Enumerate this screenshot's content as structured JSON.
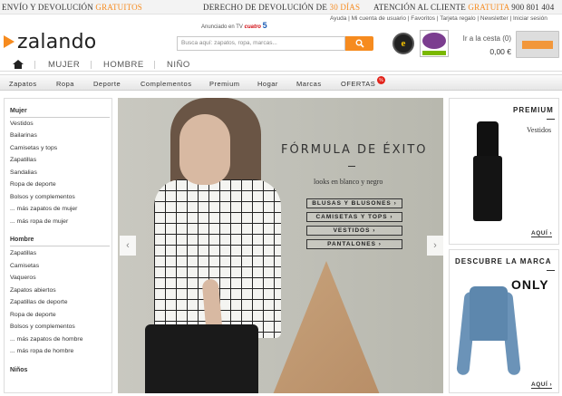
{
  "topbar": {
    "left_text": "ENVÍO Y DEVOLUCIÓN",
    "left_highlight": "GRATUITOS",
    "mid_text": "DERECHO DE DEVOLUCIÓN DE",
    "mid_highlight": "30 DÍAS",
    "right_text": "ATENCIÓN AL CLIENTE",
    "right_highlight": "GRATUITA",
    "right_phone": "900 801 404"
  },
  "header": {
    "logo_text": "zalando",
    "tv_ad_text": "Anunciado en TV",
    "tv_channel_1": "cuatro",
    "tv_channel_2": "5",
    "util_links": [
      "Ayuda",
      "Mi cuenta de usuario",
      "Favoritos",
      "Tarjeta regalo",
      "Newsletter",
      "Iniciar sesión"
    ],
    "search_placeholder": "Busca aquí: zapatos, ropa, marcas...",
    "trust_badge": "e",
    "cart_label": "Ir a la cesta (0)",
    "cart_amount": "0,00 €"
  },
  "gender_tabs": [
    "MUJER",
    "HOMBRE",
    "NIÑO"
  ],
  "categories": [
    "Zapatos",
    "Ropa",
    "Deporte",
    "Complementos",
    "Premium",
    "Hogar",
    "Marcas",
    "OFERTAS"
  ],
  "ofertas_badge": "%",
  "sidebar": {
    "mujer_heading": "Mujer",
    "mujer_items": [
      "Vestidos",
      "Bailarinas",
      "Camisetas y tops",
      "Zapatillas",
      "Sandalias",
      "Ropa de deporte",
      "Bolsos y complementos",
      "... más zapatos de mujer",
      "... más ropa de mujer"
    ],
    "hombre_heading": "Hombre",
    "hombre_items": [
      "Zapatillas",
      "Camisetas",
      "Vaqueros",
      "Zapatos abiertos",
      "Zapatillas de deporte",
      "Ropa de deporte",
      "Bolsos y complementos",
      "... más zapatos de hombre",
      "... más ropa de hombre"
    ],
    "ninos_heading": "Niños"
  },
  "hero": {
    "title": "FÓRMULA DE ÉXITO",
    "subtitle": "looks en blanco y negro",
    "buttons": [
      "BLUSAS Y BLUSONES",
      "CAMISETAS Y TOPS",
      "VESTIDOS",
      "PANTALONES"
    ],
    "prev_arrow": "‹",
    "next_arrow": "›"
  },
  "promo_premium": {
    "title": "PREMIUM",
    "subtitle": "Vestidos",
    "link": "AQUÍ"
  },
  "promo_brand": {
    "title": "DESCUBRE LA MARCA",
    "brand": "ONLY",
    "link": "AQUÍ"
  },
  "colors": {
    "accent": "#f68b1f",
    "badge_red": "#e2231a"
  }
}
